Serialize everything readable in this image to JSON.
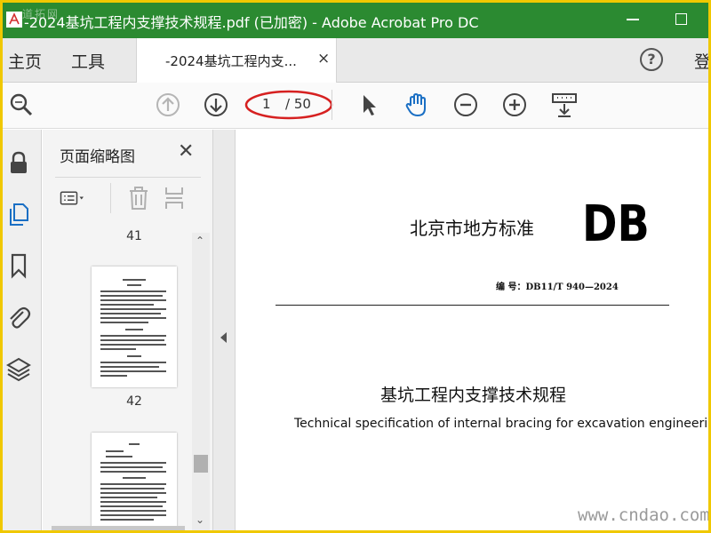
{
  "window": {
    "title": "-2024基坑工程内支撑技术规程.pdf  (已加密)  - Adobe Acrobat Pro DC",
    "watermark_top": "道拓网",
    "accent_color": "#2b8a31"
  },
  "menu": {
    "home": "主页",
    "tools": "工具",
    "login": "登",
    "help_label": "?"
  },
  "tabs": [
    {
      "label": "-2024基坑工程内支...",
      "close": "×"
    }
  ],
  "toolbar": {
    "icons": [
      "search-zoom-icon",
      "page-up-icon",
      "page-down-icon",
      "select-cursor-icon",
      "hand-tool-icon",
      "zoom-out-icon",
      "zoom-in-icon",
      "keyboard-scroll-icon"
    ],
    "current_page": "1",
    "total_pages": "/ 50"
  },
  "sidebar_rail": {
    "icons": [
      "lock-icon",
      "pages-icon",
      "bookmark-icon",
      "attachment-icon",
      "layers-icon"
    ]
  },
  "thumbnails_panel": {
    "title": "页面缩略图",
    "close": "✕",
    "page_labels": [
      "41",
      "42"
    ]
  },
  "document": {
    "standard_label": "北京市地方标准",
    "logo": "DB",
    "number": "编  号：DB11/T 940—2024",
    "title_cn": "基坑工程内支撑技术规程",
    "title_en": "Technical specification of internal bracing for excavation engineering"
  },
  "watermark_bottom": "www.cndao.com"
}
